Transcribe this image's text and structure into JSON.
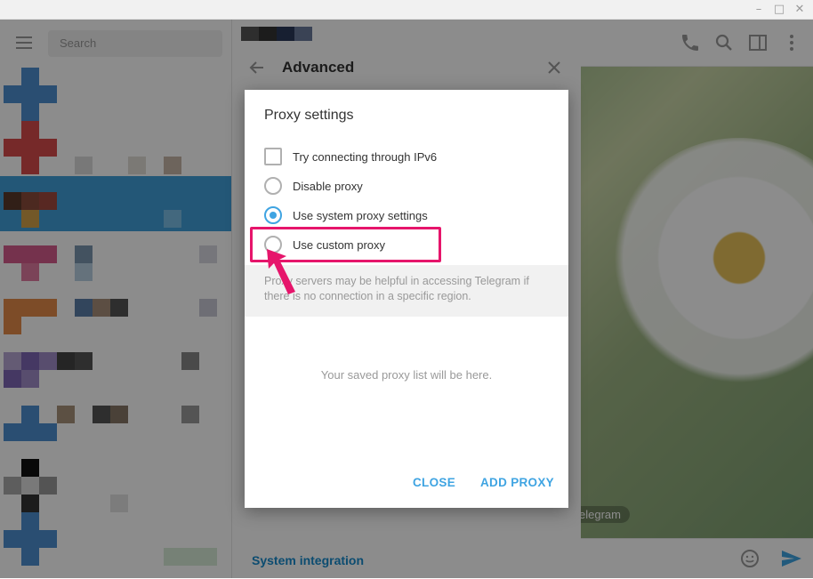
{
  "sidebar": {
    "search_placeholder": "Search"
  },
  "advanced": {
    "title": "Advanced",
    "system_integration": "System integration"
  },
  "wallpaper_badge": "elegram",
  "dialog": {
    "title": "Proxy settings",
    "options": [
      {
        "type": "checkbox",
        "label": "Try connecting through IPv6",
        "checked": false
      },
      {
        "type": "radio",
        "label": "Disable proxy",
        "checked": false
      },
      {
        "type": "radio",
        "label": "Use system proxy settings",
        "checked": true
      },
      {
        "type": "radio",
        "label": "Use custom proxy",
        "checked": false
      }
    ],
    "about": "Proxy servers may be helpful in accessing Telegram if there is no connection in a specific region.",
    "empty_list": "Your saved proxy list will be here.",
    "close_label": "CLOSE",
    "add_label": "ADD PROXY"
  },
  "colors": {
    "accent": "#3fa4e2",
    "highlight": "#e6156b",
    "link": "#168acd"
  },
  "icons": [
    "menu-icon",
    "phone-icon",
    "search-icon",
    "sidebar-toggle-icon",
    "more-icon",
    "back-arrow-icon",
    "close-icon",
    "emoji-icon",
    "send-icon"
  ]
}
